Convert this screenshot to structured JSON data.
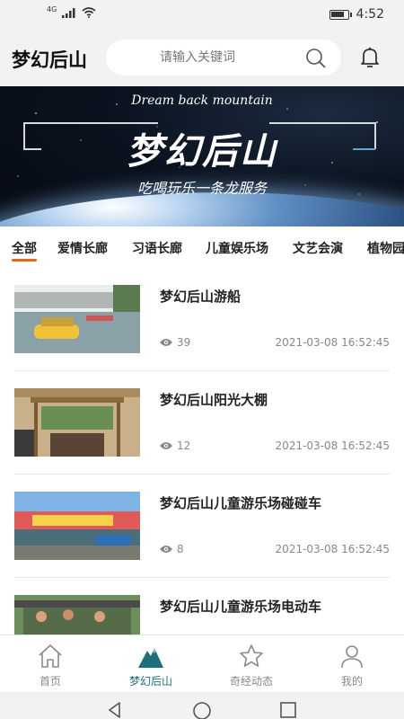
{
  "status_bar": {
    "network": "4G",
    "time": "4:52",
    "battery_level": 0.8,
    "icons": [
      "signal-icon",
      "wifi-icon",
      "battery-icon"
    ]
  },
  "header": {
    "title": "梦幻后山",
    "search_placeholder": "请输入关键词"
  },
  "banner": {
    "subtitle_en": "Dream back mountain",
    "title": "梦幻后山",
    "slogan": "吃喝玩乐一条龙服务"
  },
  "tabs": [
    "全部",
    "爱情长廊",
    "习语长廊",
    "儿童娱乐场",
    "文艺会演",
    "植物园"
  ],
  "active_tab": 0,
  "articles": [
    {
      "title": "梦幻后山游船",
      "views": "39",
      "date": "2021-03-08 16:52:45"
    },
    {
      "title": "梦幻后山阳光大棚",
      "views": "12",
      "date": "2021-03-08 16:52:45"
    },
    {
      "title": "梦幻后山儿童游乐场碰碰车",
      "views": "8",
      "date": "2021-03-08 16:52:45"
    },
    {
      "title": "梦幻后山儿童游乐场电动车",
      "views": "",
      "date": ""
    }
  ],
  "bottom_nav": [
    {
      "label": "首页",
      "icon": "home-icon"
    },
    {
      "label": "梦幻后山",
      "icon": "mountain-icon"
    },
    {
      "label": "奇经动态",
      "icon": "star-icon"
    },
    {
      "label": "我的",
      "icon": "user-icon"
    }
  ],
  "colors": {
    "accent": "#1e6f78",
    "tab_underline": "#e06a1a",
    "background": "#f2f2f2"
  }
}
